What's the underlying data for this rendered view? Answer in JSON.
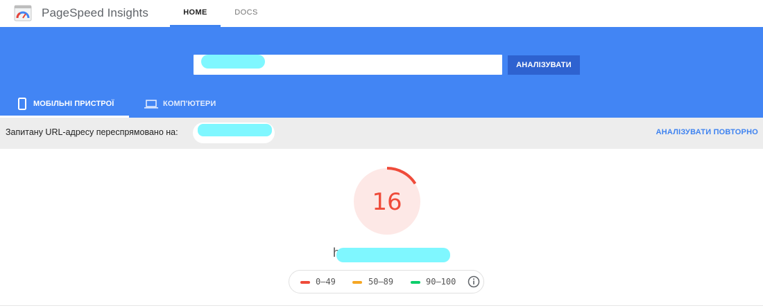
{
  "app": {
    "brand": "PageSpeed Insights",
    "logo_icon": "pagespeed-gauge-icon"
  },
  "nav": {
    "tabs": [
      {
        "label": "HOME",
        "active": true
      },
      {
        "label": "DOCS",
        "active": false
      }
    ]
  },
  "search": {
    "value": "",
    "analyze_label": "АНАЛІЗУВАТИ"
  },
  "device_tabs": [
    {
      "label": "МОБІЛЬНІ ПРИСТРОЇ",
      "icon": "smartphone-icon",
      "active": true
    },
    {
      "label": "КОМП'ЮТЕРИ",
      "icon": "laptop-icon",
      "active": false
    }
  ],
  "redirect": {
    "text": "Запитану URL-адресу переспрямовано на:",
    "url": "",
    "reanalyze_label": "АНАЛІЗУВАТИ ПОВТОРНО"
  },
  "score": {
    "value": "16",
    "fraction": 0.16,
    "color": "#ef4b3a",
    "bg_color": "#fde8e6"
  },
  "legend": {
    "items": [
      {
        "label": "0–49",
        "color": "#ef4b3a"
      },
      {
        "label": "50–89",
        "color": "#f5a623"
      },
      {
        "label": "90–100",
        "color": "#0cce6b"
      }
    ],
    "info_icon": "info-icon"
  },
  "colors": {
    "brand_blue": "#4285f4",
    "button_blue": "#2e62d0",
    "link_blue": "#3f83f0"
  }
}
